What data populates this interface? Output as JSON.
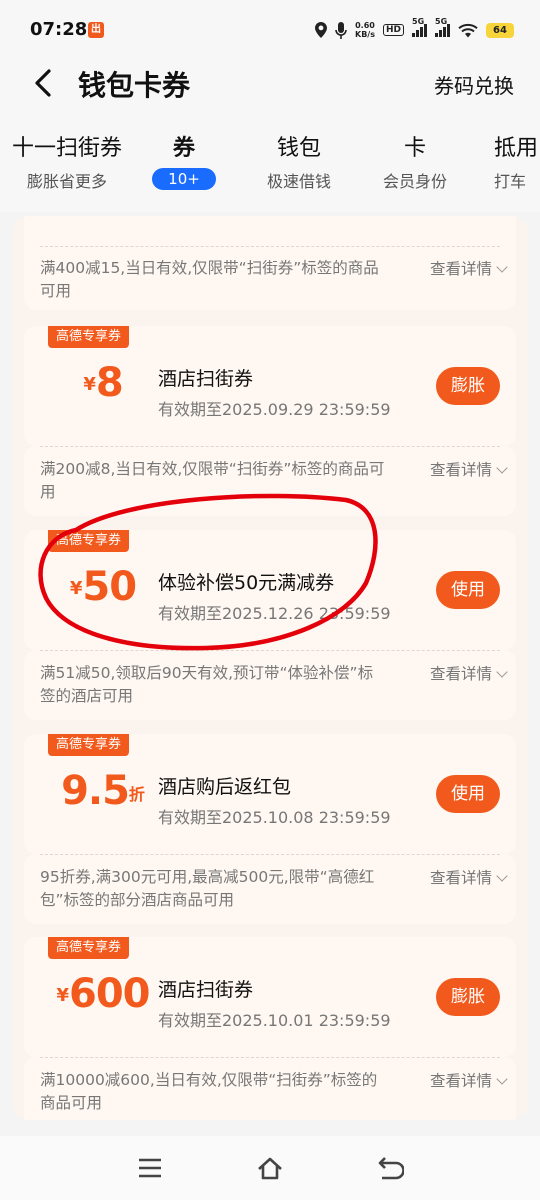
{
  "status": {
    "time": "07:28",
    "app_icon_text": "出",
    "speed_value": "0.60",
    "speed_unit": "KB/s",
    "hd_label": "HD",
    "sim1": "5G",
    "sim2": "5G",
    "battery": "64",
    "battery_color": "#f6d43a"
  },
  "header": {
    "title": "钱包卡券",
    "redeem_label": "券码兑换"
  },
  "tabs": [
    {
      "title": "十一扫街券",
      "sub": "膨胀省更多"
    },
    {
      "title": "券",
      "badge": "10+"
    },
    {
      "title": "钱包",
      "sub": "极速借钱"
    },
    {
      "title": "卡",
      "sub": "会员身份"
    },
    {
      "title": "抵用",
      "sub": "打车"
    }
  ],
  "detail_link_label": "查看详情",
  "first_detail": "满400减15,当日有效,仅限带“扫街券”标签的商品可用",
  "coupons": [
    {
      "tag": "高德专享券",
      "currency": "¥",
      "amount": "8",
      "unit": "",
      "name": "酒店扫街券",
      "expiry": "有效期至2025.09.29 23:59:59",
      "button": "膨胀",
      "detail": "满200减8,当日有效,仅限带“扫街券”标签的商品可用"
    },
    {
      "tag": "高德专享券",
      "currency": "¥",
      "amount": "50",
      "unit": "",
      "name": "体验补偿50元满减券",
      "expiry": "有效期至2025.12.26 23:59:59",
      "button": "使用",
      "detail": "满51减50,领取后90天有效,预订带“体验补偿”标签的酒店可用"
    },
    {
      "tag": "高德专享券",
      "currency": "",
      "amount": "9.5",
      "unit": "折",
      "name": "酒店购后返红包",
      "expiry": "有效期至2025.10.08 23:59:59",
      "button": "使用",
      "detail": "95折券,满300元可用,最高减500元,限带“高德红包”标签的部分酒店商品可用"
    },
    {
      "tag": "高德专享券",
      "currency": "¥",
      "amount": "600",
      "unit": "",
      "name": "酒店扫街券",
      "expiry": "有效期至2025.10.01 23:59:59",
      "button": "膨胀",
      "detail": "满10000减600,当日有效,仅限带“扫街券”标签的商品可用"
    }
  ],
  "colors": {
    "accent": "#f25a1d",
    "badge_blue": "#1a6cff",
    "annotation_red": "#e3000b"
  }
}
